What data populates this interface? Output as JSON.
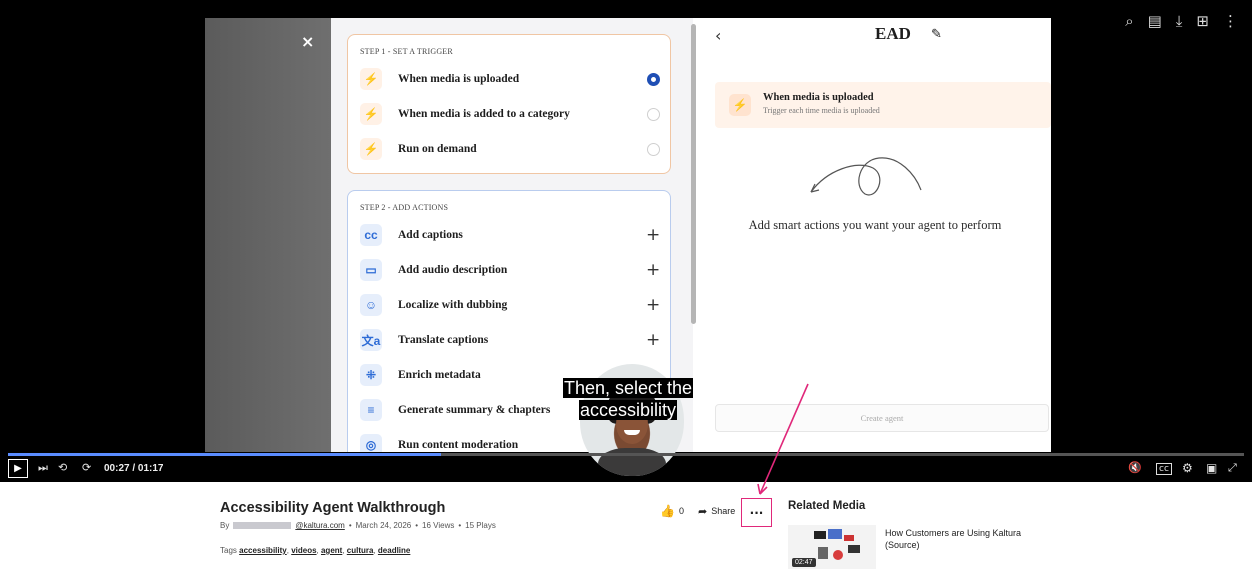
{
  "video": {
    "close_symbol": "×",
    "step1": {
      "label": "STEP 1 - SET A TRIGGER",
      "items": [
        {
          "label": "When media is uploaded",
          "selected": true
        },
        {
          "label": "When media is added to a category",
          "selected": false
        },
        {
          "label": "Run on demand",
          "selected": false
        }
      ]
    },
    "step2": {
      "label": "STEP 2 - ADD ACTIONS",
      "items": [
        {
          "label": "Add captions",
          "icon": "captions-icon",
          "glyph": "cc"
        },
        {
          "label": "Add audio description",
          "icon": "audio-description-icon",
          "glyph": "▭"
        },
        {
          "label": "Localize with dubbing",
          "icon": "dubbing-icon",
          "glyph": "☺"
        },
        {
          "label": "Translate captions",
          "icon": "translate-icon",
          "glyph": "文a"
        },
        {
          "label": "Enrich metadata",
          "icon": "metadata-icon",
          "glyph": "⁜"
        },
        {
          "label": "Generate summary & chapters",
          "icon": "summary-icon",
          "glyph": "≡"
        },
        {
          "label": "Run content moderation",
          "icon": "moderation-icon",
          "glyph": "◎"
        }
      ]
    },
    "agent_panel": {
      "back_symbol": "‹",
      "name": "EAD",
      "trigger_title": "When media is uploaded",
      "trigger_subtitle": "Trigger each time media is uploaded",
      "empty_text": "Add smart actions you want your agent to perform",
      "create_label": "Create agent"
    },
    "caption_lines": [
      "Then, select the",
      "accessibility"
    ]
  },
  "player": {
    "current_time": "00:27",
    "duration": "01:17",
    "time_display": "00:27 / 01:17",
    "progress": 0.35,
    "skip_back_seconds": "10",
    "skip_forward_seconds": "10"
  },
  "media": {
    "title": "Accessibility Agent Walkthrough",
    "by_prefix": "By",
    "email_domain": "@kaltura.com",
    "date": "March 24, 2026",
    "views": "16 Views",
    "plays": "15 Plays",
    "separator": "•",
    "tags_label": "Tags",
    "tags": [
      "accessibility",
      "videos",
      "agent",
      "cultura",
      "deadline"
    ],
    "likes": "0",
    "share_label": "Share",
    "more_symbol": "···"
  },
  "related": {
    "heading": "Related Media",
    "items": [
      {
        "title": "How Customers are Using Kaltura (Source)",
        "duration": "02:47"
      }
    ]
  },
  "colors": {
    "accent_orange": "#f26a1b",
    "selected_blue": "#1f4fb5",
    "progress_blue": "#5a8cff",
    "annotation_pink": "#e0287a"
  }
}
